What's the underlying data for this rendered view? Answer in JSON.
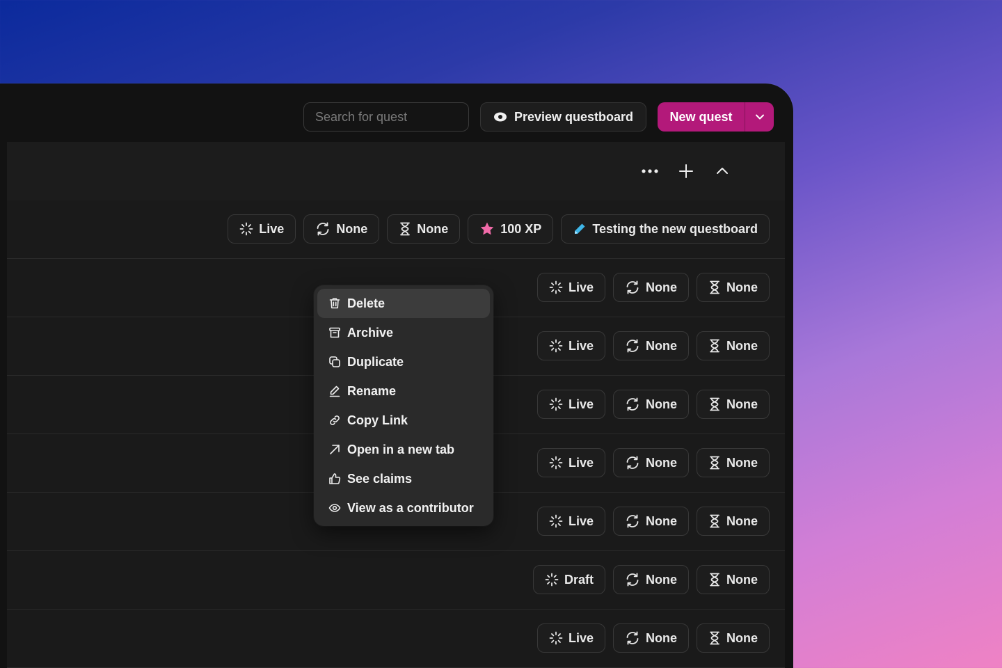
{
  "toolbar": {
    "search_placeholder": "Search for quest",
    "preview_label": "Preview questboard",
    "new_quest_label": "New quest"
  },
  "colors": {
    "accent": "#b3197a",
    "star": "#f06aa8",
    "pencil": "#3fb6e8"
  },
  "first_row": {
    "chips": [
      {
        "icon": "loader-icon",
        "label": "Live"
      },
      {
        "icon": "refresh-icon",
        "label": "None"
      },
      {
        "icon": "hourglass-icon",
        "label": "None"
      },
      {
        "icon": "star-icon",
        "label": "100 XP"
      },
      {
        "icon": "pencil-icon",
        "label": "Testing the new questboard"
      }
    ]
  },
  "rows": [
    {
      "status": "Live",
      "recurrence": "None",
      "duration": "None"
    },
    {
      "status": "Live",
      "recurrence": "None",
      "duration": "None"
    },
    {
      "status": "Live",
      "recurrence": "None",
      "duration": "None"
    },
    {
      "status": "Live",
      "recurrence": "None",
      "duration": "None"
    },
    {
      "status": "Live",
      "recurrence": "None",
      "duration": "None"
    },
    {
      "status": "Draft",
      "recurrence": "None",
      "duration": "None"
    },
    {
      "status": "Live",
      "recurrence": "None",
      "duration": "None"
    }
  ],
  "context_menu": {
    "items": [
      {
        "icon": "trash-icon",
        "label": "Delete"
      },
      {
        "icon": "archive-icon",
        "label": "Archive"
      },
      {
        "icon": "duplicate-icon",
        "label": "Duplicate"
      },
      {
        "icon": "pen-icon",
        "label": "Rename"
      },
      {
        "icon": "link-icon",
        "label": "Copy Link"
      },
      {
        "icon": "external-arrow-icon",
        "label": "Open in a new tab"
      },
      {
        "icon": "thumbs-up-icon",
        "label": "See claims"
      },
      {
        "icon": "eye-icon",
        "label": "View as a contributor"
      }
    ]
  }
}
